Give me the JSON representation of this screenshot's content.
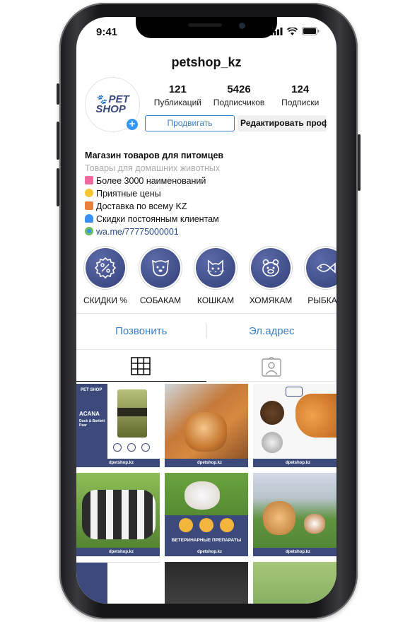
{
  "status": {
    "time": "9:41"
  },
  "profile": {
    "username": "petshop_kz",
    "logo_line1": "PET",
    "logo_line2": "SHOP",
    "stats": [
      {
        "value": "121",
        "label": "Публикаций"
      },
      {
        "value": "5426",
        "label": "Подписчиков"
      },
      {
        "value": "124",
        "label": "Подписки"
      }
    ],
    "promote_label": "Продвигать",
    "edit_label": "Редактировать проф"
  },
  "bio": {
    "name": "Магазин товаров для питомцев",
    "category": "Товары для домашних животных",
    "lines": [
      {
        "icon": "shopping-bag-icon",
        "text": "Более 3000 наименований"
      },
      {
        "icon": "thumbs-up-icon",
        "text": "Приятные цены"
      },
      {
        "icon": "delivery-truck-icon",
        "text": "Доставка по всему KZ"
      },
      {
        "icon": "blue-heart-icon",
        "text": "Скидки постоянным клиентам"
      },
      {
        "icon": "globe-icon",
        "text": "wa.me/77775000001"
      }
    ]
  },
  "highlights": [
    {
      "icon": "discount-badge-icon",
      "label": "СКИДКИ %"
    },
    {
      "icon": "dog-icon",
      "label": "СОБАКАМ"
    },
    {
      "icon": "cat-icon",
      "label": "КОШКАМ"
    },
    {
      "icon": "hamster-icon",
      "label": "ХОМЯКАМ"
    },
    {
      "icon": "fish-icon",
      "label": "РЫБКАМ"
    }
  ],
  "contact": {
    "call_label": "Позвонить",
    "email_label": "Эл.адрес"
  },
  "tabs": [
    {
      "icon": "grid-icon"
    },
    {
      "icon": "tagged-person-icon"
    }
  ],
  "posts": [
    {
      "caption": "ACANA",
      "subtitle": "Duck & Bartlett Pear",
      "strip_text": "dpetshop.kz"
    },
    {
      "caption": "",
      "strip_text": "dpetshop.kz"
    },
    {
      "caption": "",
      "strip_text": "dpetshop.kz"
    },
    {
      "caption": "",
      "strip_text": "dpetshop.kz"
    },
    {
      "caption": "ВЕТЕРИНАРНЫЕ ПРЕПАРАТЫ",
      "strip_text": "dpetshop.kz"
    },
    {
      "caption": "",
      "strip_text": "dpetshop.kz"
    }
  ],
  "colors": {
    "brand": "#3b4a7a",
    "link": "#3b7fc4",
    "accent": "#3897f0"
  }
}
